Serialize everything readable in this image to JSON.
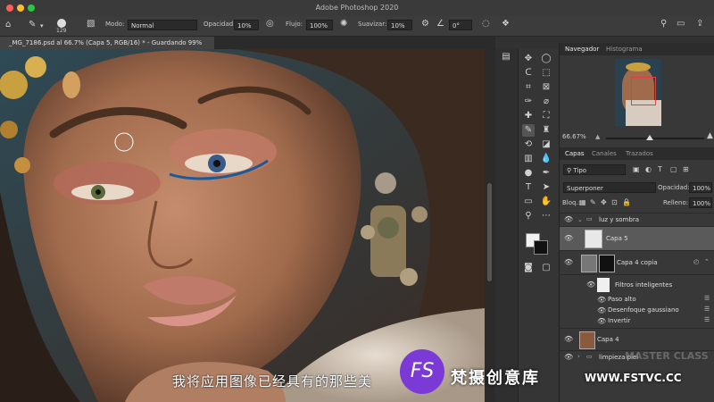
{
  "window": {
    "title": "Adobe Photoshop 2020"
  },
  "options_bar": {
    "brush_size": "129",
    "mode_label": "Modo:",
    "mode_value": "Normal",
    "opacity_label": "Opacidad:",
    "opacity_value": "10%",
    "flow_label": "Flujo:",
    "flow_value": "100%",
    "smooth_label": "Suavizar:",
    "smooth_value": "10%",
    "angle_value": "0°"
  },
  "document": {
    "tab_label": "_MG_7186.psd al 66.7% (Capa 5, RGB/16) * - Guardando 99%"
  },
  "navigator": {
    "tabs": [
      "Navegador",
      "Histograma"
    ],
    "zoom": "66.67%"
  },
  "layers_panel": {
    "tabs": [
      "Capas",
      "Canales",
      "Trazados"
    ],
    "filter_value": "Tipo",
    "blend_mode": "Superponer",
    "opacity_label": "Opacidad:",
    "opacity_value": "100%",
    "lock_label": "Bloq.:",
    "fill_label": "Relleno:",
    "fill_value": "100%",
    "layers": [
      {
        "name": "luz y sombra"
      },
      {
        "name": "Capa 5"
      },
      {
        "name": "Capa 4 copia"
      },
      {
        "name": "Filtros inteligentes"
      },
      {
        "name": "Paso alto"
      },
      {
        "name": "Desenfoque gaussiano"
      },
      {
        "name": "Invertir"
      },
      {
        "name": "Capa 4"
      },
      {
        "name": "limpieza piel"
      }
    ]
  },
  "overlay": {
    "subtitle": "我将应用图像已经具有的那些美",
    "logo_text": "FS",
    "brand_cn": "梵摄创意库",
    "brand_url": "WWW.FSTVC.CC",
    "watermark": "MASTER CLASS"
  },
  "colors": {
    "accent": "#7b3ad6",
    "close": "#ff5f57",
    "minimize": "#febc2e",
    "zoom": "#28c840"
  }
}
